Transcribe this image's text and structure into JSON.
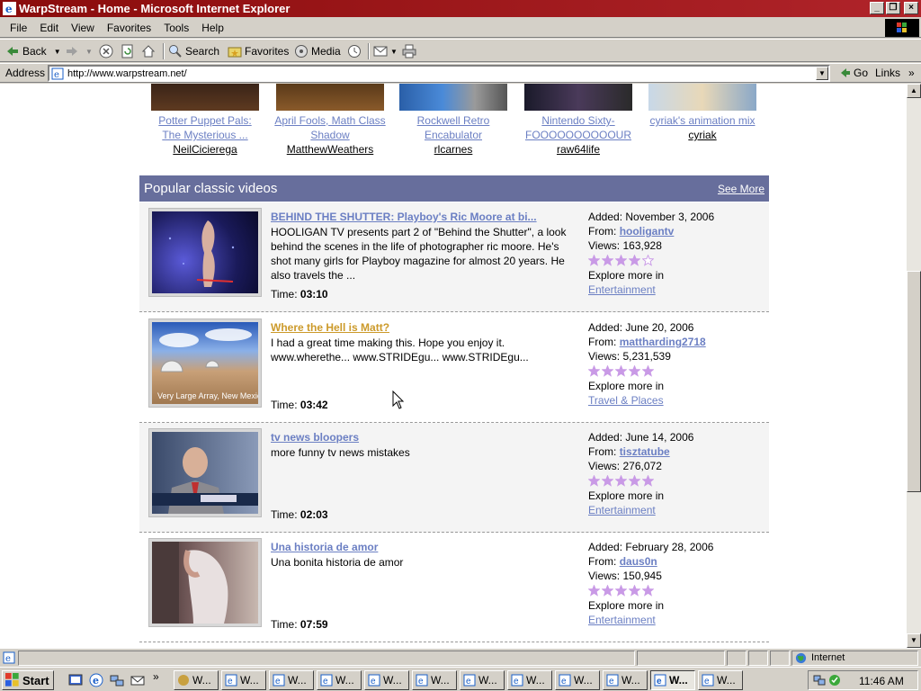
{
  "window": {
    "title": "WarpStream - Home - Microsoft Internet Explorer"
  },
  "menu": [
    "File",
    "Edit",
    "View",
    "Favorites",
    "Tools",
    "Help"
  ],
  "toolbar": {
    "back": "Back",
    "search": "Search",
    "favorites": "Favorites",
    "media": "Media"
  },
  "address": {
    "label": "Address",
    "url": "http://www.warpstream.net/",
    "go": "Go",
    "links": "Links",
    "chevron": "»"
  },
  "top_videos": [
    {
      "title_lines": [
        "Potter Puppet Pals:",
        "The Mysterious ..."
      ],
      "user": "NeilCicierega"
    },
    {
      "title_lines": [
        "April Fools, Math Class",
        "Shadow"
      ],
      "user": "MatthewWeathers"
    },
    {
      "title_lines": [
        "Rockwell Retro",
        "Encabulator"
      ],
      "user": "rlcarnes"
    },
    {
      "title_lines": [
        "Nintendo Sixty-",
        "FOOOOOOOOOOUR"
      ],
      "user": "raw64life"
    },
    {
      "title_lines": [
        "cyriak's animation mix"
      ],
      "user": "cyriak"
    }
  ],
  "section": {
    "title": "Popular classic videos",
    "see_more": "See More"
  },
  "videos": [
    {
      "title": "BEHIND THE SHUTTER: Playboy's Ric Moore at bi...",
      "desc": "HOOLIGAN TV presents part 2 of \"Behind the Shutter\", a look behind the scenes in the life of photographer ric moore. He's shot many girls for Playboy magazine for almost 20 years. He also travels the ...",
      "time_label": "Time:",
      "time": "03:10",
      "added_label": "Added:",
      "added": "November 3, 2006",
      "from_label": "From:",
      "from": "hooligantv",
      "views_label": "Views:",
      "views": "163,928",
      "rating": 4,
      "explore": "Explore more in",
      "category": "Entertainment"
    },
    {
      "title": "Where the Hell is Matt?",
      "desc": "I had a great time making this. Hope you enjoy it. www.wherethe... www.STRIDEgu... www.STRIDEgu...",
      "time_label": "Time:",
      "time": "03:42",
      "added_label": "Added:",
      "added": "June 20, 2006",
      "from_label": "From:",
      "from": "mattharding2718",
      "views_label": "Views:",
      "views": "5,231,539",
      "rating": 5,
      "explore": "Explore more in",
      "category": "Travel & Places",
      "thumb_caption": "Very Large Array, New Mexico"
    },
    {
      "title": "tv news bloopers",
      "desc": "more funny tv news mistakes",
      "time_label": "Time:",
      "time": "02:03",
      "added_label": "Added:",
      "added": "June 14, 2006",
      "from_label": "From:",
      "from": "tisztatube",
      "views_label": "Views:",
      "views": "276,072",
      "rating": 5,
      "explore": "Explore more in",
      "category": "Entertainment"
    },
    {
      "title": "Una historia de amor",
      "desc": "Una bonita historia de amor",
      "time_label": "Time:",
      "time": "07:59",
      "added_label": "Added:",
      "added": "February 28, 2006",
      "from_label": "From:",
      "from": "daus0n",
      "views_label": "Views:",
      "views": "150,945",
      "rating": 5,
      "explore": "Explore more in",
      "category": "Entertainment"
    }
  ],
  "status": {
    "zone": "Internet"
  },
  "taskbar": {
    "start": "Start",
    "tasks": [
      "W...",
      "W...",
      "W...",
      "W...",
      "W...",
      "W...",
      "W...",
      "W...",
      "W...",
      "W...",
      "W...",
      "W..."
    ],
    "active_index": 10,
    "clock": "11:46 AM"
  },
  "colors": {
    "link": "#6b7fc3",
    "visited": "#cc9a2a",
    "header": "#676e9c",
    "star": "#c99ae6",
    "titlebar": "#8a0c0c"
  }
}
